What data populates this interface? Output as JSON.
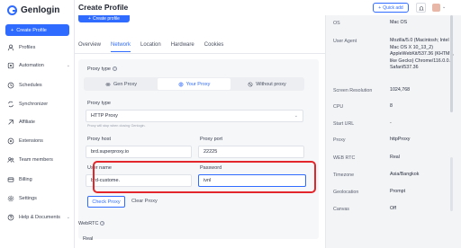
{
  "app": {
    "name": "Genlogin",
    "brand_color": "#2f6bff",
    "highlight_color": "#e2262b"
  },
  "sidebar": {
    "create_label": "Create Profile",
    "items": [
      {
        "label": "Profiles",
        "icon": "profile-icon"
      },
      {
        "label": "Automation",
        "icon": "automation-icon",
        "has_chevron": true
      },
      {
        "label": "Schedules",
        "icon": "clock-icon"
      },
      {
        "label": "Synchronizer",
        "icon": "sync-icon"
      },
      {
        "label": "Affiliate",
        "icon": "affiliate-icon"
      },
      {
        "label": "Extensions",
        "icon": "extension-icon"
      },
      {
        "label": "Team members",
        "icon": "team-icon"
      },
      {
        "label": "Billing",
        "icon": "billing-icon"
      },
      {
        "label": "Settings",
        "icon": "gear-icon"
      },
      {
        "label": "Help & Documents",
        "icon": "help-icon",
        "has_chevron": true
      }
    ]
  },
  "header": {
    "title": "Create Profile",
    "quick_add": "Quick add"
  },
  "main": {
    "create_button": "Create profile",
    "tabs": [
      "Overview",
      "Network",
      "Location",
      "Hardware",
      "Cookies"
    ],
    "active_tab": "Network",
    "proxy_type_label": "Proxy type",
    "proxy_options": [
      "Gen Proxy",
      "Your Proxy",
      "Without proxy"
    ],
    "active_proxy_option": "Your Proxy",
    "proxy_type_field_label": "Proxy type",
    "proxy_type_value": "HTTP Proxy",
    "proxy_hint": "Proxy will stop when closing Genlogin.",
    "proxy_host_label": "Proxy host",
    "proxy_host_value": "brd.superproxy.io",
    "proxy_port_label": "Proxy port",
    "proxy_port_value": "22225",
    "username_label": "User name",
    "username_value": "brd-custome.",
    "password_label": "Password",
    "password_value": "ivnl",
    "check_proxy": "Check Proxy",
    "clear_proxy": "Clear Proxy",
    "webrtc_label": "WebRTC",
    "webrtc_value": "Real"
  },
  "details": [
    {
      "key": "OS",
      "value": "Mac OS"
    },
    {
      "key": "User Agent",
      "value": "Mozilla/5.0 (Macintosh; Intel Mac OS X 10_13_2) AppleWebKit/537.36 (KHTML, like Gecko) Chrome/116.0.0.0 Safari/537.36"
    },
    {
      "key": "Screen Resolution",
      "value": "1024,768"
    },
    {
      "key": "CPU",
      "value": "8"
    },
    {
      "key": "Start URL",
      "value": "-"
    },
    {
      "key": "Proxy",
      "value": "httpProxy"
    },
    {
      "key": "WEB RTC",
      "value": "Real"
    },
    {
      "key": "Timezone",
      "value": "Asia/Bangkok"
    },
    {
      "key": "Geolocation",
      "value": "Prompt"
    },
    {
      "key": "Canvas",
      "value": "Off"
    }
  ]
}
